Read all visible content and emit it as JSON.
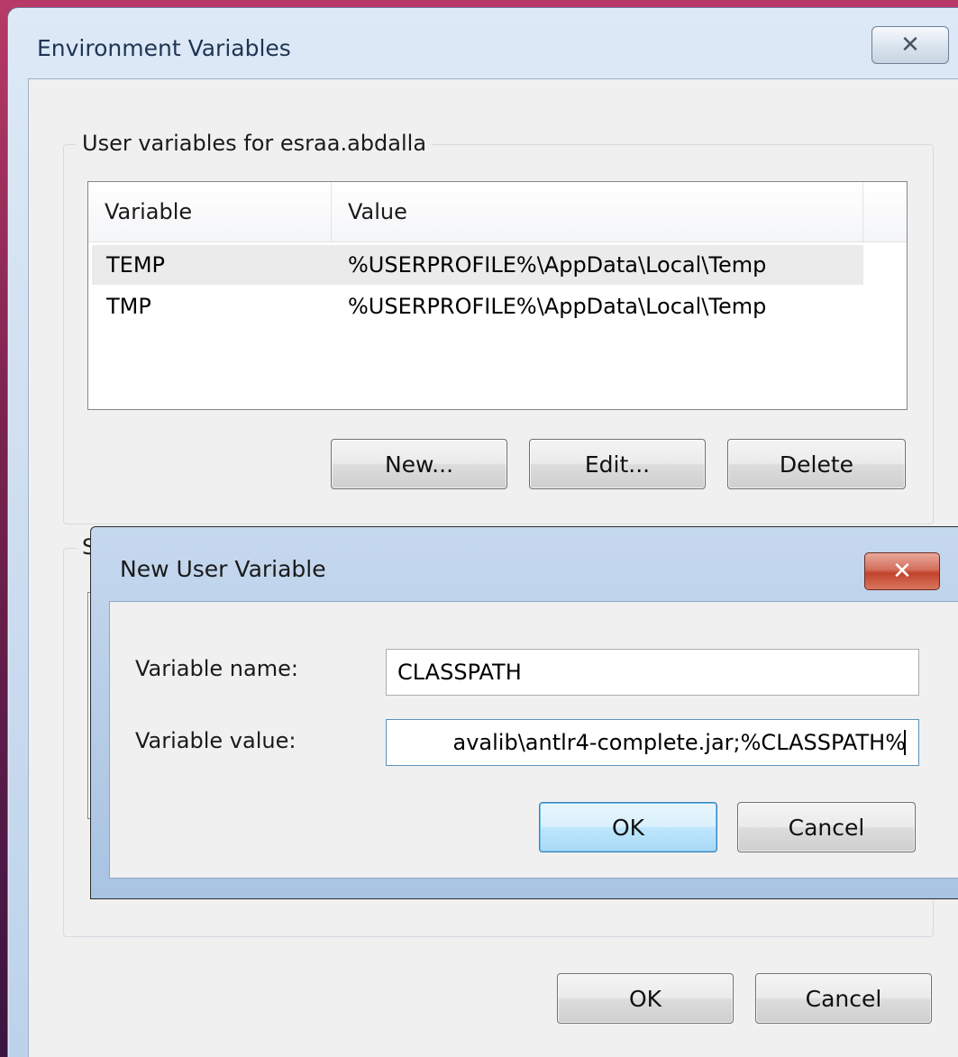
{
  "env_dialog": {
    "title": "Environment Variables",
    "close_glyph": "✕",
    "user_group_label": "User variables for esraa.abdalla",
    "system_group_label_visible": "S",
    "columns": [
      "Variable",
      "Value"
    ],
    "rows": [
      {
        "variable": "TEMP",
        "value": "%USERPROFILE%\\AppData\\Local\\Temp",
        "selected": true
      },
      {
        "variable": "TMP",
        "value": "%USERPROFILE%\\AppData\\Local\\Temp",
        "selected": false
      }
    ],
    "buttons": {
      "new": "New...",
      "edit": "Edit...",
      "delete": "Delete"
    },
    "ok_label": "OK",
    "cancel_label": "Cancel"
  },
  "new_var_dialog": {
    "title": "New User Variable",
    "close_glyph": "✕",
    "name_label": "Variable name:",
    "name_value": "CLASSPATH",
    "value_label": "Variable value:",
    "value_value": "avalib\\antlr4-complete.jar;%CLASSPATH%",
    "ok_label": "OK",
    "cancel_label": "Cancel"
  }
}
